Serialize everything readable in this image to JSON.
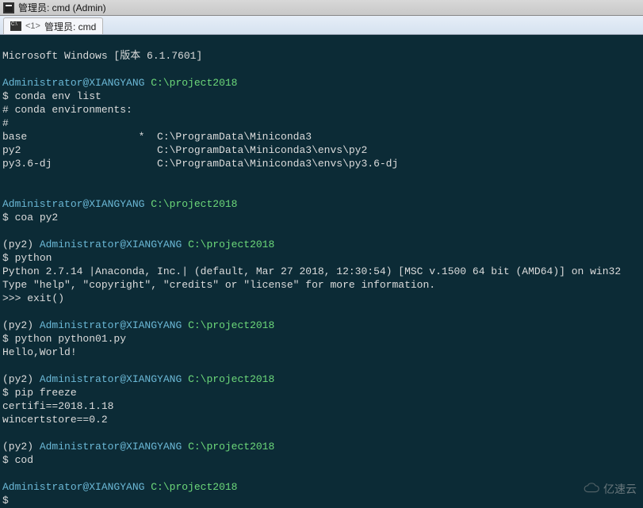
{
  "window": {
    "title": "管理员: cmd (Admin)"
  },
  "tab": {
    "num_prefix": "<1>",
    "label": "管理员: cmd"
  },
  "lines": {
    "ms_version": "Microsoft Windows [版本 6.1.7601]",
    "user_host": "Administrator@XIANGYANG",
    "path": "C:\\project2018",
    "cmd1": "conda env list",
    "env_header": "# conda environments:",
    "env_hash": "#",
    "env_base": "base                  *  C:\\ProgramData\\Miniconda3",
    "env_py2": "py2                      C:\\ProgramData\\Miniconda3\\envs\\py2",
    "env_py36": "py3.6-dj                 C:\\ProgramData\\Miniconda3\\envs\\py3.6-dj",
    "cmd2": "coa py2",
    "env_prefix": "(py2) ",
    "cmd3": "python",
    "py_banner1": "Python 2.7.14 |Anaconda, Inc.| (default, Mar 27 2018, 12:30:54) [MSC v.1500 64 bit (AMD64)] on win32",
    "py_banner2": "Type \"help\", \"copyright\", \"credits\" or \"license\" for more information.",
    "py_exit": ">>> exit()",
    "cmd4": "python python01.py",
    "hello": "Hello,World!",
    "cmd5": "pip freeze",
    "pip1": "certifi==2018.1.18",
    "pip2": "wincertstore==0.2",
    "cmd6": "cod",
    "dollar": "$ ",
    "dollar_only": "$"
  },
  "watermark": {
    "text": "亿速云"
  }
}
